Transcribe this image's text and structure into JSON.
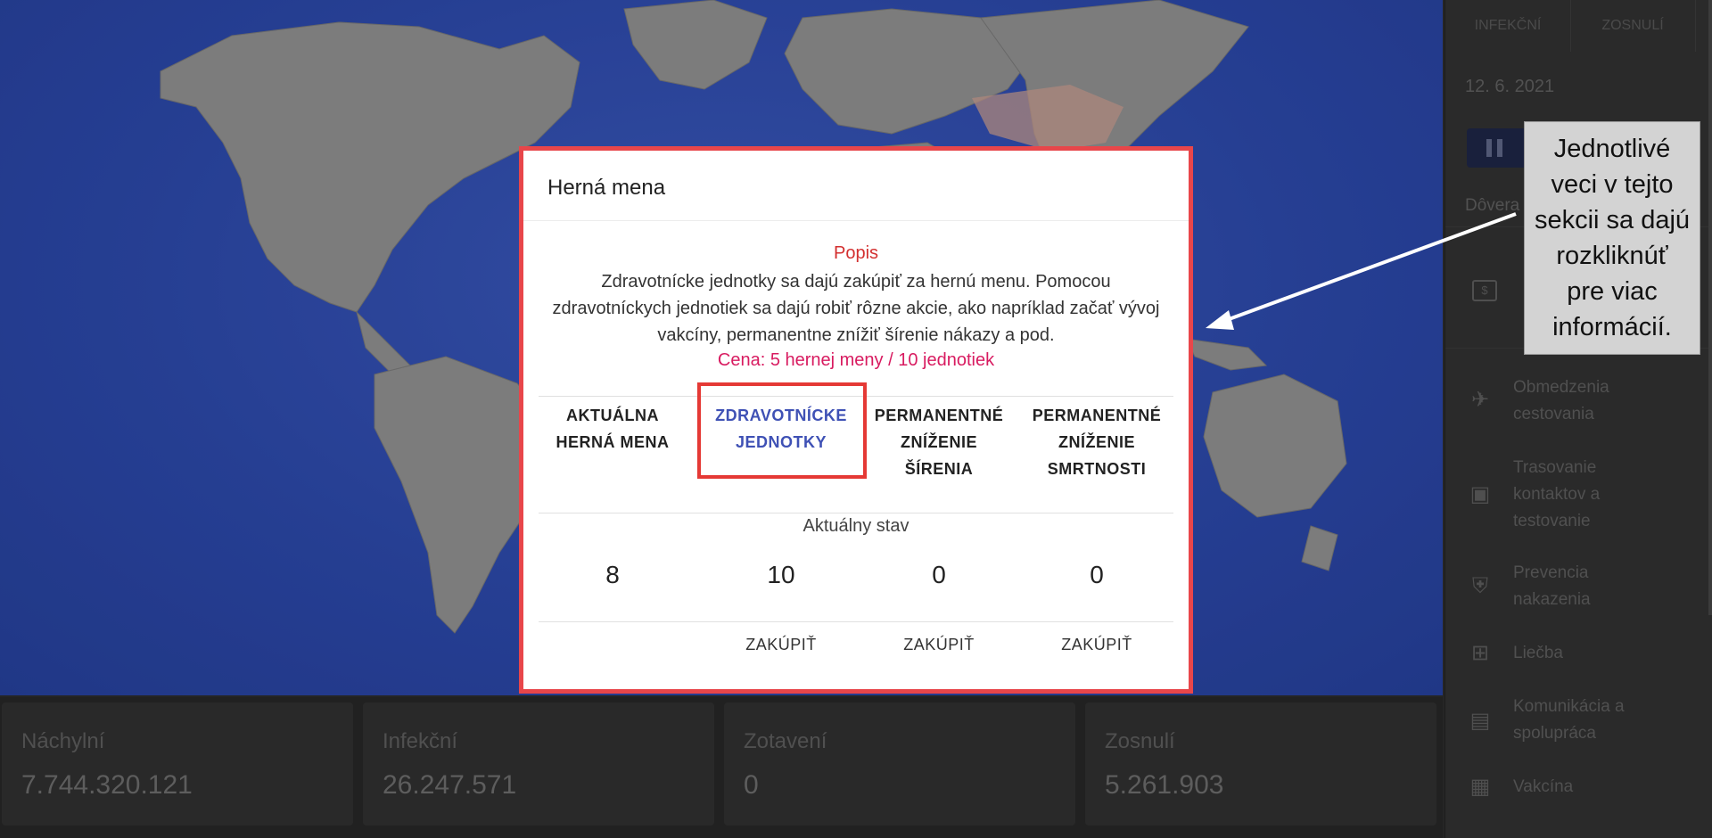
{
  "dialog": {
    "title": "Herná mena",
    "description_title": "Popis",
    "description": "Zdravotnícke jednotky sa dajú zakúpiť za hernú menu. Pomocou zdravotníckych jednotiek sa dajú robiť rôzne akcie, ako napríklad začať vývoj vakcíny, permanentne znížiť šírenie nákazy a pod.",
    "price": "Cena: 5 hernej meny / 10 jednotiek",
    "status_label": "Aktuálny stav",
    "columns": [
      {
        "header_line1": "AKTUÁLNA",
        "header_line2": "HERNÁ MENA",
        "header_line3": "",
        "count": "8",
        "buy_label": ""
      },
      {
        "header_line1": "ZDRAVOTNÍCKE",
        "header_line2": "JEDNOTKY",
        "header_line3": "",
        "count": "10",
        "buy_label": "ZAKÚPIŤ"
      },
      {
        "header_line1": "PERMANENTNÉ",
        "header_line2": "ZNÍŽENIE",
        "header_line3": "ŠÍRENIA",
        "count": "0",
        "buy_label": "ZAKÚPIŤ"
      },
      {
        "header_line1": "PERMANENTNÉ",
        "header_line2": "ZNÍŽENIE",
        "header_line3": "SMRTNOSTI",
        "count": "0",
        "buy_label": "ZAKÚPIŤ"
      }
    ]
  },
  "stats": [
    {
      "label": "Náchylní",
      "value": "7.744.320.121"
    },
    {
      "label": "Infekční",
      "value": "26.247.571"
    },
    {
      "label": "Zotavení",
      "value": "0"
    },
    {
      "label": "Zosnulí",
      "value": "5.261.903"
    }
  ],
  "panel": {
    "tabs": [
      "INFEKČNÍ",
      "ZOSNULÍ"
    ],
    "date": "12. 6. 2021",
    "trust_label": "Dôvera",
    "currency_icon_text": "$",
    "items": [
      {
        "icon": "airplane-off-icon",
        "label_line1": "Obmedzenia",
        "label_line2": "cestovania",
        "label_line3": ""
      },
      {
        "icon": "contact-badge-icon",
        "label_line1": "Trasovanie",
        "label_line2": "kontaktov a",
        "label_line3": "testovanie"
      },
      {
        "icon": "shield-icon",
        "label_line1": "Prevencia",
        "label_line2": "nakazenia",
        "label_line3": ""
      },
      {
        "icon": "medical-plus-icon",
        "label_line1": "Liečba",
        "label_line2": "",
        "label_line3": ""
      },
      {
        "icon": "chat-icon",
        "label_line1": "Komunikácia a",
        "label_line2": "spolupráca",
        "label_line3": ""
      },
      {
        "icon": "vaccine-icon",
        "label_line1": "Vakcína",
        "label_line2": "",
        "label_line3": ""
      }
    ]
  },
  "annotation": {
    "line1": "Jednotlivé",
    "line2": "veci v tejto",
    "line3": "sekcii sa dajú",
    "line4": "rozkliknúť",
    "line5": "pre viac",
    "line6": "informácií."
  },
  "colors": {
    "ocean": "#2c48a8",
    "land": "#8d8d8d",
    "dialog_border": "#e8464a",
    "accent_blue": "#3f51b5",
    "description_red": "#d32f2f",
    "price_pink": "#d81b60"
  }
}
